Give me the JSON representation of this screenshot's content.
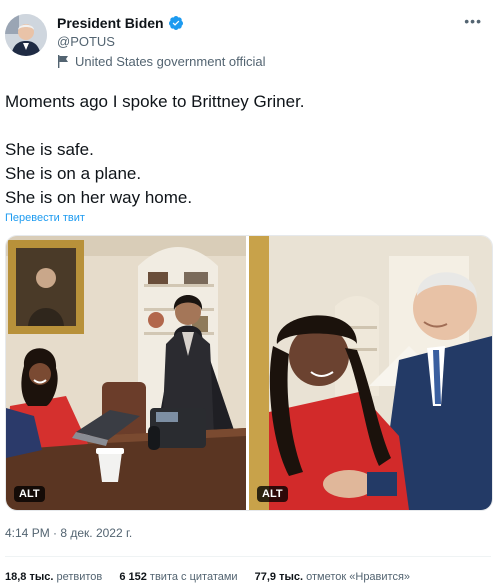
{
  "author": {
    "name": "President Biden",
    "handle": "@POTUS",
    "label": "United States government official"
  },
  "tweet": {
    "line1": "Moments ago I spoke to Brittney Griner.",
    "line2": "She is safe.",
    "line3": "She is on a plane.",
    "line4": "She is on her way home.",
    "translate_label": "Перевести твит"
  },
  "media": {
    "left_alt_label": "ALT",
    "right_alt_label": "ALT"
  },
  "timestamp": "4:14 PM · 8 дек. 2022 г.",
  "stats": {
    "retweets_count": "18,8 тыс.",
    "retweets_label": "ретвитов",
    "quotes_count": "6 152",
    "quotes_label": "твита с цитатами",
    "likes_count": "77,9 тыс.",
    "likes_label": "отметок «Нравится»"
  },
  "colors": {
    "accent": "#1d9bf0",
    "secondary_text": "#536471"
  }
}
